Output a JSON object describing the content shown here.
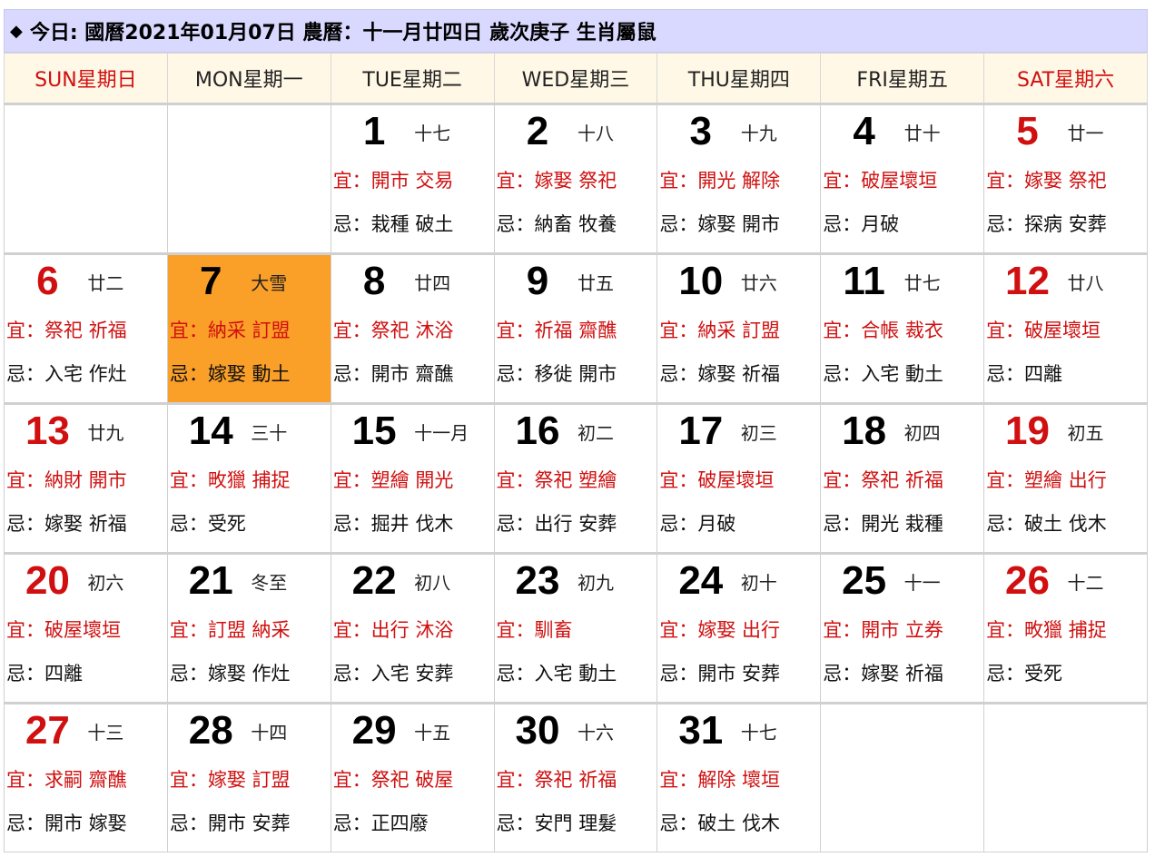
{
  "header": {
    "text": "今日: 國曆2021年01月07日  農曆：十一月廿四日  歲次庚子  生肖屬鼠"
  },
  "weekdays": [
    {
      "label": "SUN星期日",
      "weekend": true
    },
    {
      "label": "MON星期一",
      "weekend": false
    },
    {
      "label": "TUE星期二",
      "weekend": false
    },
    {
      "label": "WED星期三",
      "weekend": false
    },
    {
      "label": "THU星期四",
      "weekend": false
    },
    {
      "label": "FRI星期五",
      "weekend": false
    },
    {
      "label": "SAT星期六",
      "weekend": true
    }
  ],
  "weeks": [
    [
      null,
      null,
      {
        "day": "1",
        "lunar": "十七",
        "yi": "宜：開市 交易",
        "ji": "忌：栽種 破土"
      },
      {
        "day": "2",
        "lunar": "十八",
        "yi": "宜：嫁娶 祭祀",
        "ji": "忌：納畜 牧養"
      },
      {
        "day": "3",
        "lunar": "十九",
        "yi": "宜：開光 解除",
        "ji": "忌：嫁娶 開市"
      },
      {
        "day": "4",
        "lunar": "廿十",
        "yi": "宜：破屋壞垣",
        "ji": "忌：月破"
      },
      {
        "day": "5",
        "lunar": "廿一",
        "yi": "宜：嫁娶 祭祀",
        "ji": "忌：探病 安葬"
      }
    ],
    [
      {
        "day": "6",
        "lunar": "廿二",
        "yi": "宜：祭祀 祈福",
        "ji": "忌：入宅 作灶"
      },
      {
        "day": "7",
        "lunar": "大雪",
        "yi": "宜：納采 訂盟",
        "ji": "忌：嫁娶 動土",
        "today": true
      },
      {
        "day": "8",
        "lunar": "廿四",
        "yi": "宜：祭祀 沐浴",
        "ji": "忌：開市 齋醮"
      },
      {
        "day": "9",
        "lunar": "廿五",
        "yi": "宜：祈福 齋醮",
        "ji": "忌：移徙 開市"
      },
      {
        "day": "10",
        "lunar": "廿六",
        "yi": "宜：納采 訂盟",
        "ji": "忌：嫁娶 祈福"
      },
      {
        "day": "11",
        "lunar": "廿七",
        "yi": "宜：合帳 裁衣",
        "ji": "忌：入宅 動土"
      },
      {
        "day": "12",
        "lunar": "廿八",
        "yi": "宜：破屋壞垣",
        "ji": "忌：四離"
      }
    ],
    [
      {
        "day": "13",
        "lunar": "廿九",
        "yi": "宜：納財 開市",
        "ji": "忌：嫁娶 祈福"
      },
      {
        "day": "14",
        "lunar": "三十",
        "yi": "宜：畋獵 捕捉",
        "ji": "忌：受死"
      },
      {
        "day": "15",
        "lunar": "十一月",
        "yi": "宜：塑繪 開光",
        "ji": "忌：掘井 伐木"
      },
      {
        "day": "16",
        "lunar": "初二",
        "yi": "宜：祭祀 塑繪",
        "ji": "忌：出行 安葬"
      },
      {
        "day": "17",
        "lunar": "初三",
        "yi": "宜：破屋壞垣",
        "ji": "忌：月破"
      },
      {
        "day": "18",
        "lunar": "初四",
        "yi": "宜：祭祀 祈福",
        "ji": "忌：開光 栽種"
      },
      {
        "day": "19",
        "lunar": "初五",
        "yi": "宜：塑繪 出行",
        "ji": "忌：破土 伐木"
      }
    ],
    [
      {
        "day": "20",
        "lunar": "初六",
        "yi": "宜：破屋壞垣",
        "ji": "忌：四離"
      },
      {
        "day": "21",
        "lunar": "冬至",
        "yi": "宜：訂盟 納采",
        "ji": "忌：嫁娶 作灶"
      },
      {
        "day": "22",
        "lunar": "初八",
        "yi": "宜：出行 沐浴",
        "ji": "忌：入宅 安葬"
      },
      {
        "day": "23",
        "lunar": "初九",
        "yi": "宜：馴畜",
        "ji": "忌：入宅 動土"
      },
      {
        "day": "24",
        "lunar": "初十",
        "yi": "宜：嫁娶 出行",
        "ji": "忌：開市 安葬"
      },
      {
        "day": "25",
        "lunar": "十一",
        "yi": "宜：開市 立券",
        "ji": "忌：嫁娶 祈福"
      },
      {
        "day": "26",
        "lunar": "十二",
        "yi": "宜：畋獵 捕捉",
        "ji": "忌：受死"
      }
    ],
    [
      {
        "day": "27",
        "lunar": "十三",
        "yi": "宜：求嗣 齋醮",
        "ji": "忌：開市 嫁娶"
      },
      {
        "day": "28",
        "lunar": "十四",
        "yi": "宜：嫁娶 訂盟",
        "ji": "忌：開市 安葬"
      },
      {
        "day": "29",
        "lunar": "十五",
        "yi": "宜：祭祀 破屋",
        "ji": "忌：正四廢"
      },
      {
        "day": "30",
        "lunar": "十六",
        "yi": "宜：祭祀 祈福",
        "ji": "忌：安門 理髮"
      },
      {
        "day": "31",
        "lunar": "十七",
        "yi": "宜：解除 壞垣",
        "ji": "忌：破土 伐木"
      },
      null,
      null
    ]
  ],
  "colors": {
    "header_bg": "#d9d9ff",
    "weekday_bg": "#fff8e6",
    "weekend_red": "#d01010",
    "today_bg": "#fa9f28"
  }
}
